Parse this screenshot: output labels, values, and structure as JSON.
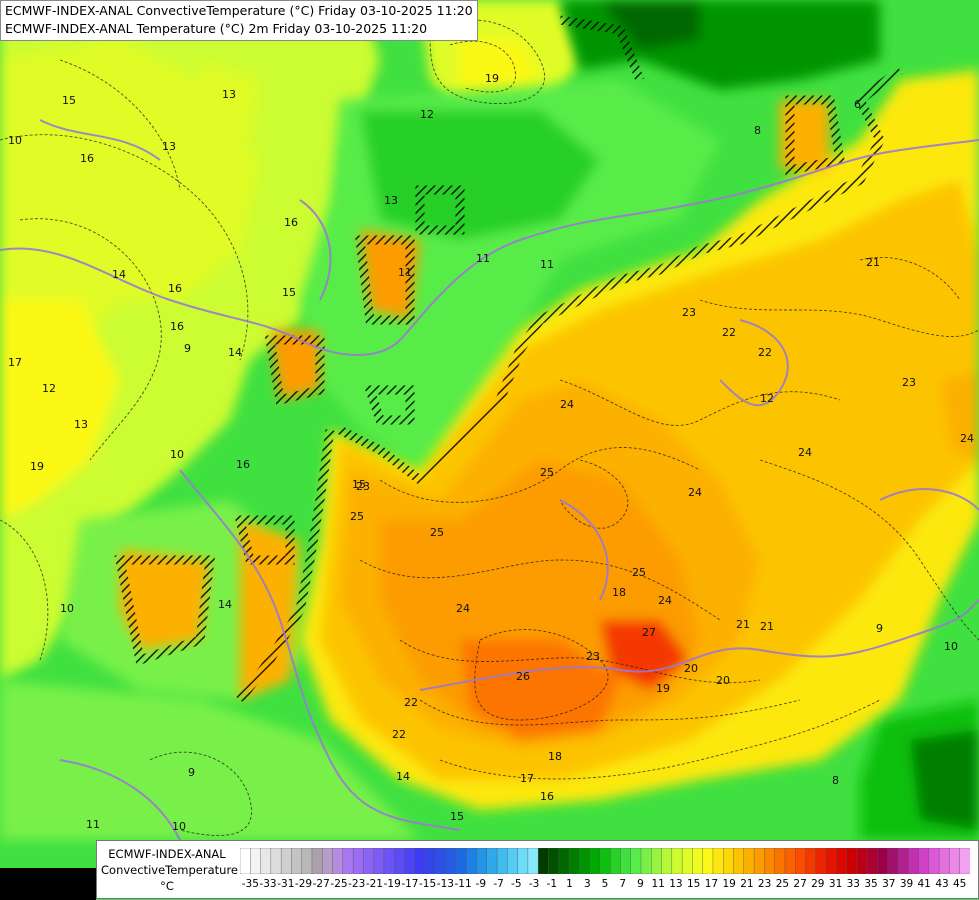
{
  "header": {
    "line1": "ECMWF-INDEX-ANAL ConvectiveTemperature (°C) Friday 03-10-2025 11:20",
    "line2": "ECMWF-INDEX-ANAL Temperature (°C) 2m Friday 03-10-2025 11:20"
  },
  "legend": {
    "model": "ECMWF-INDEX-ANAL",
    "parameter": "ConvectiveTemperature",
    "unit": "°C",
    "ticks": [
      "-35",
      "-33",
      "-31",
      "-29",
      "-27",
      "-25",
      "-23",
      "-21",
      "-19",
      "-17",
      "-15",
      "-13",
      "-11",
      "-9",
      "-7",
      "-5",
      "-3",
      "-1",
      "1",
      "3",
      "5",
      "7",
      "9",
      "11",
      "13",
      "15",
      "17",
      "19",
      "21",
      "23",
      "25",
      "27",
      "29",
      "31",
      "33",
      "35",
      "37",
      "39",
      "41",
      "43",
      "45"
    ],
    "colors": [
      "#ffffff",
      "#f4f4f4",
      "#e8e8e8",
      "#dcdcdc",
      "#d0d0d0",
      "#c4c4c4",
      "#b8b8b8",
      "#aca0ac",
      "#b49ec8",
      "#b48ce0",
      "#a878f0",
      "#9c6cf4",
      "#8c64f4",
      "#7c5cf4",
      "#6c54f4",
      "#5c4cf4",
      "#4c44f4",
      "#3c3cf4",
      "#3444ec",
      "#2c50e8",
      "#245ce4",
      "#1c6ae0",
      "#1c80e4",
      "#2494e8",
      "#30a8ec",
      "#40bcf0",
      "#54ccf4",
      "#6cdcf8",
      "#88e8fc",
      "#003c00",
      "#005200",
      "#006800",
      "#007e00",
      "#009400",
      "#00aa00",
      "#10c010",
      "#28d028",
      "#40e040",
      "#58ec48",
      "#78f048",
      "#98f440",
      "#b4f838",
      "#ccfc30",
      "#e0fc28",
      "#f0fc20",
      "#fcf818",
      "#fce810",
      "#fcd808",
      "#fcc400",
      "#fcb000",
      "#fc9c00",
      "#fc8800",
      "#fc7400",
      "#fc6000",
      "#fc4c00",
      "#f43800",
      "#ec2400",
      "#e41400",
      "#dc0800",
      "#cc0000",
      "#bc0018",
      "#ac0030",
      "#9c0048",
      "#a0106c",
      "#b02090",
      "#c030b0",
      "#d040c8",
      "#dc58d8",
      "#e470e0",
      "#ec88e8",
      "#f4a0f0"
    ],
    "color_roles": {
      "cool_green": "#28d028",
      "light_green": "#78f048",
      "yellow_green": "#ccfc30",
      "yellow": "#fcf818",
      "orange": "#fcb000",
      "dark_orange": "#fc8800",
      "red_orange": "#f43800",
      "border_lines": "#9a7ad0"
    }
  },
  "contour_labels": [
    "19",
    "13",
    "15",
    "16",
    "14",
    "12",
    "11",
    "16",
    "15",
    "13",
    "14",
    "16",
    "17",
    "10",
    "13",
    "16",
    "10",
    "19",
    "11",
    "22",
    "24",
    "23",
    "22",
    "21",
    "23",
    "24",
    "24",
    "25",
    "24",
    "25",
    "25",
    "24",
    "23",
    "26",
    "27",
    "25",
    "23",
    "24",
    "22",
    "21",
    "20",
    "19",
    "18",
    "17",
    "16",
    "15",
    "14",
    "10",
    "9",
    "11",
    "10",
    "9",
    "8",
    "21",
    "18",
    "14",
    "22",
    "15",
    "16",
    "12",
    "11",
    "13",
    "12",
    "8",
    "6",
    "9",
    "10",
    "20"
  ]
}
